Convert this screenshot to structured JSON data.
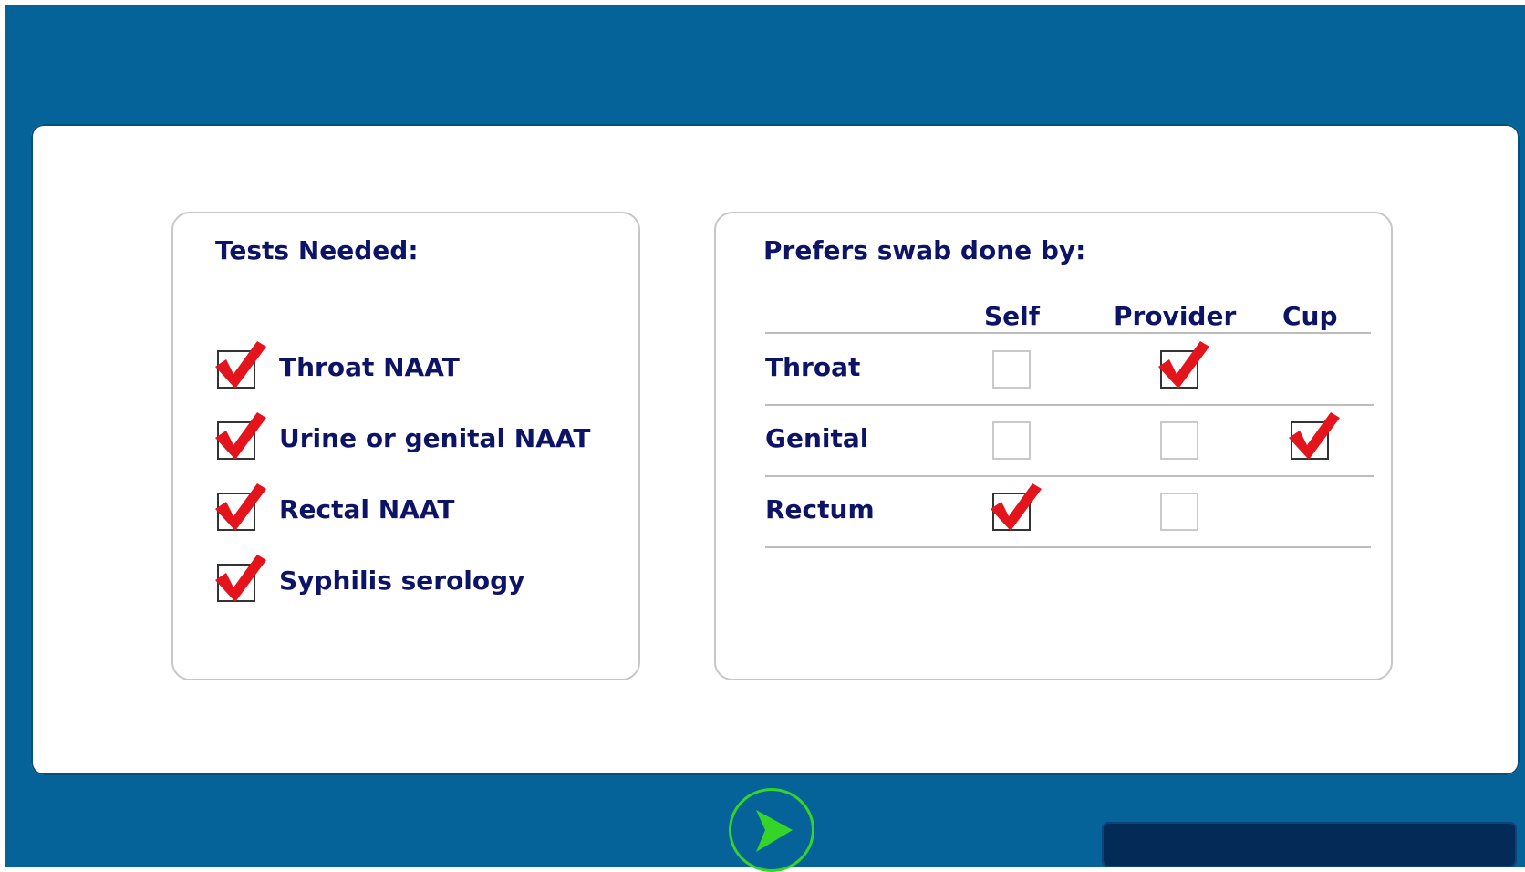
{
  "tests": {
    "title": "Tests Needed:",
    "items": [
      {
        "label": "Throat NAAT",
        "checked": true
      },
      {
        "label": "Urine or genital NAAT",
        "checked": true
      },
      {
        "label": "Rectal NAAT",
        "checked": true
      },
      {
        "label": "Syphilis serology",
        "checked": true
      }
    ]
  },
  "swab": {
    "title": "Prefers swab done by:",
    "columns": [
      "Self",
      "Provider",
      "Cup"
    ],
    "rows": [
      {
        "label": "Throat",
        "self": false,
        "provider": true
      },
      {
        "label": "Genital",
        "self": false,
        "provider": false,
        "cup": true
      },
      {
        "label": "Rectum",
        "self": true,
        "provider": false
      }
    ]
  },
  "icons": {
    "check": "checkmark-icon",
    "next": "arrow-right-icon"
  },
  "colors": {
    "background": "#05639a",
    "text": "#0d1466",
    "check": "#e4141c",
    "next_arrow": "#34d428",
    "progress_bar": "#042b58"
  }
}
